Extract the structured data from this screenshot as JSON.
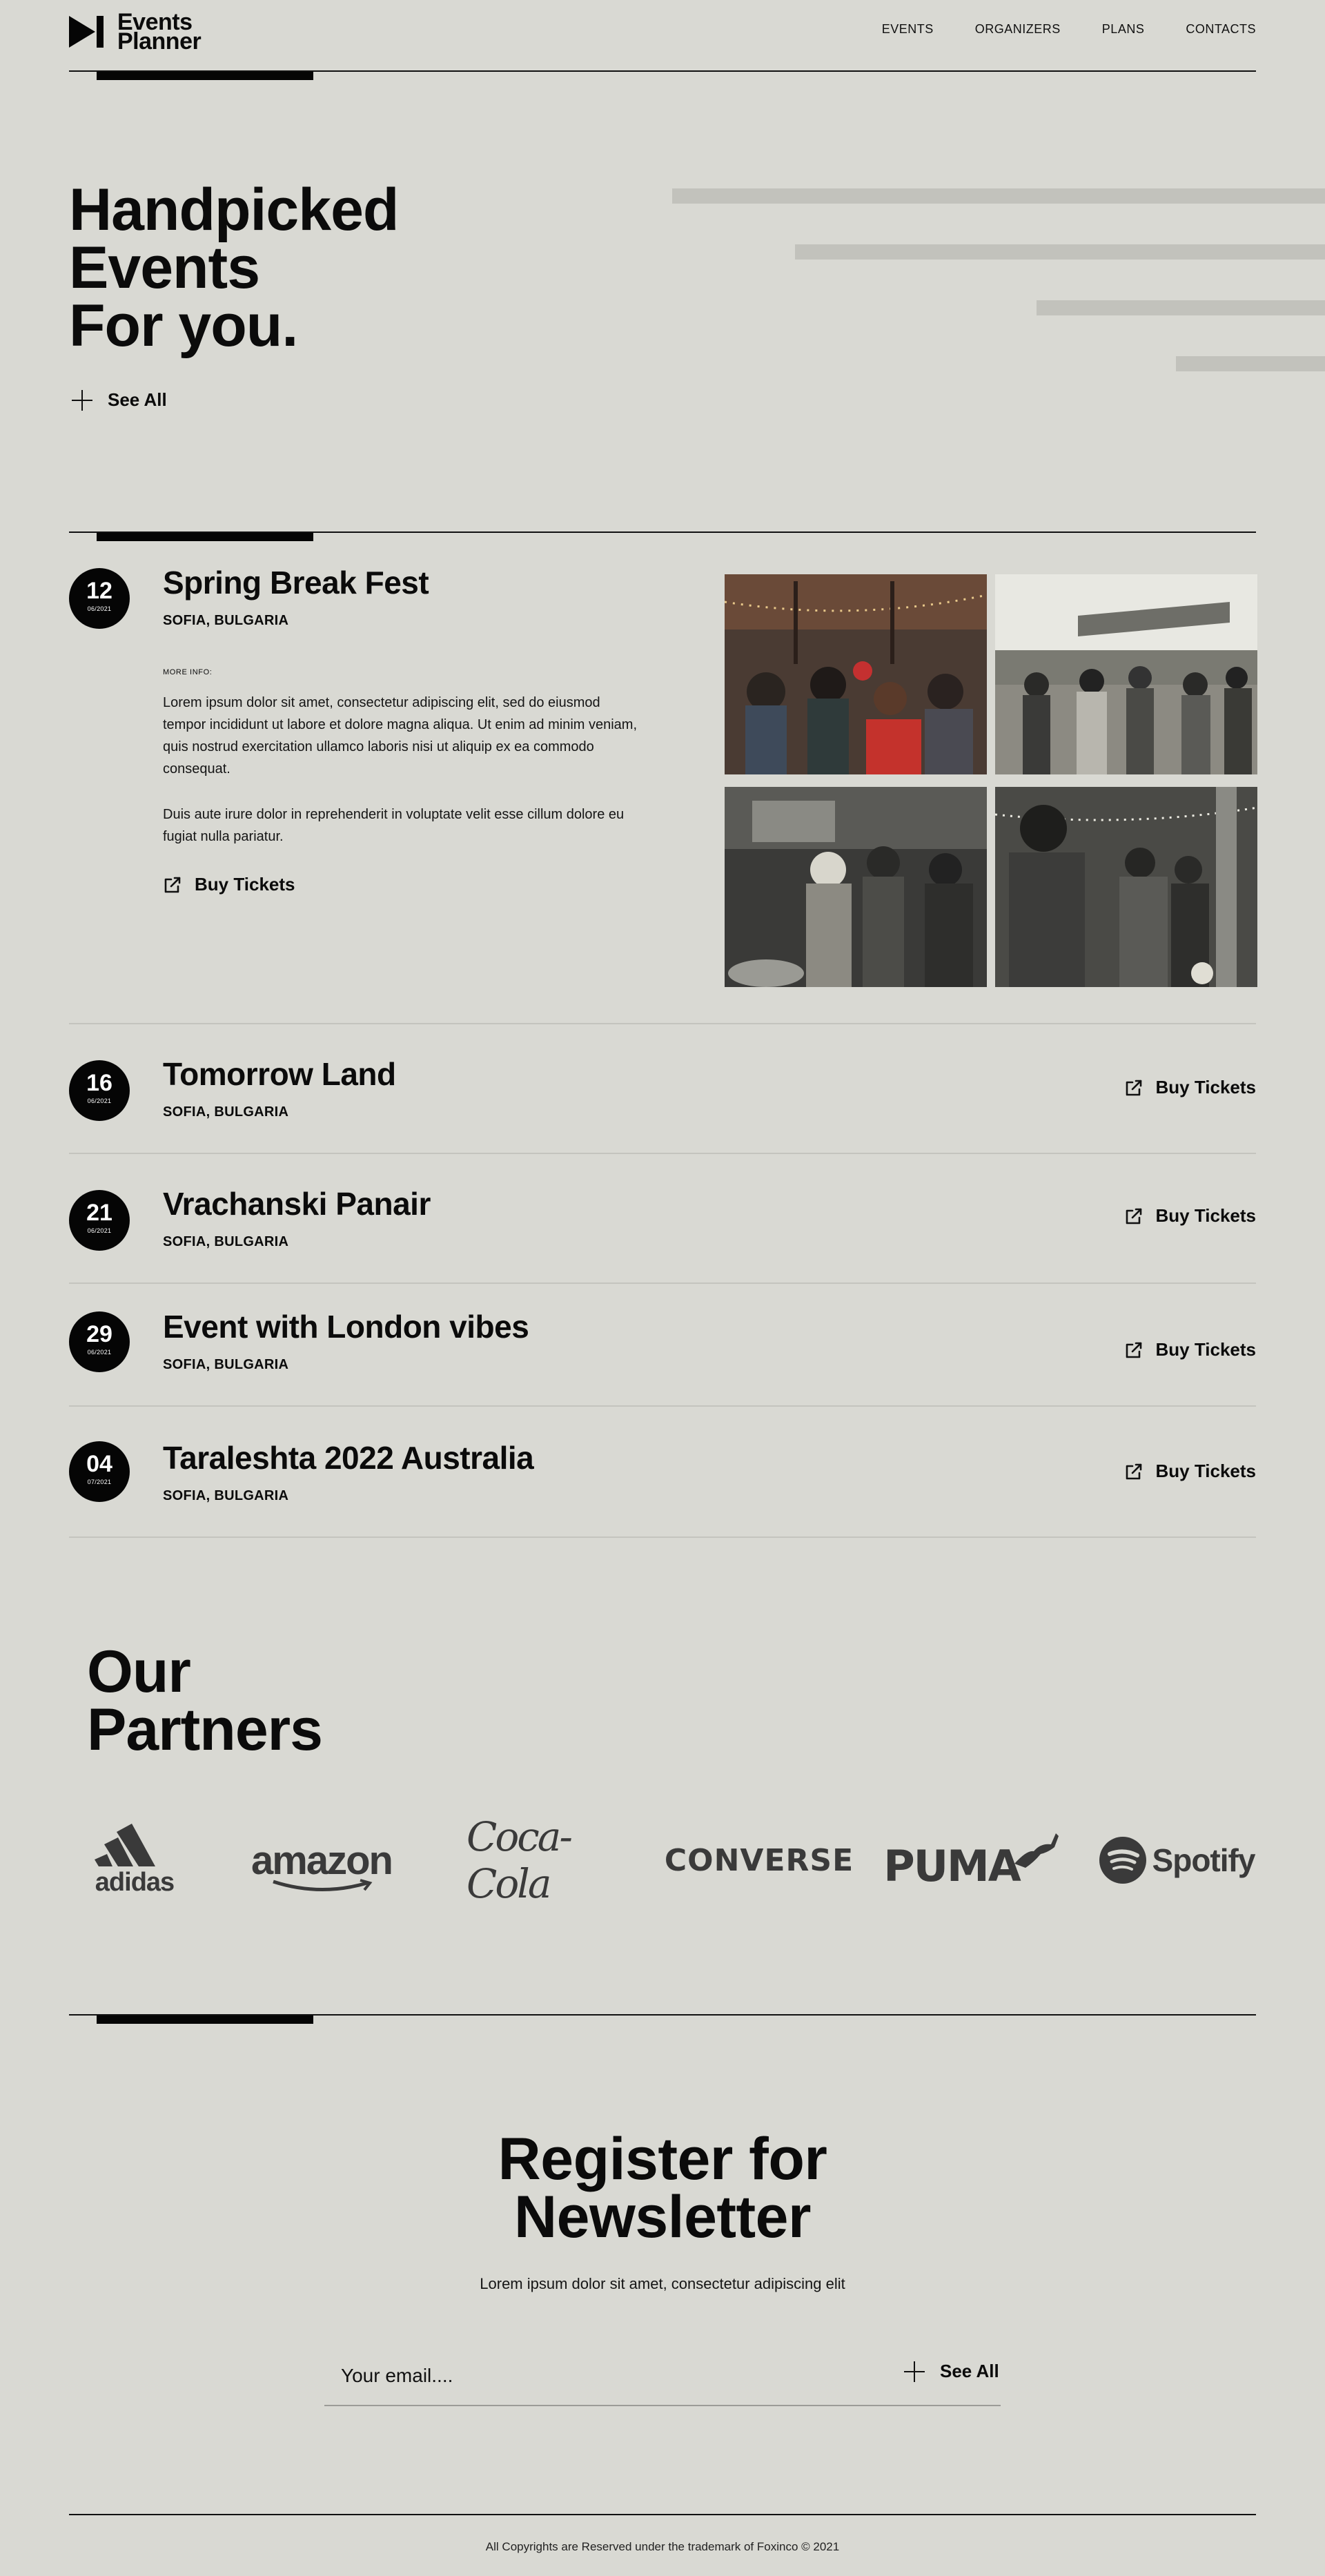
{
  "header": {
    "logo_line1": "Events",
    "logo_line2": "Planner",
    "nav": [
      "EVENTS",
      "ORGANIZERS",
      "PLANS",
      "CONTACTS"
    ]
  },
  "hero": {
    "title_line1": "Handpicked",
    "title_line2": "Events",
    "title_line3": "For you.",
    "see_all": "See All"
  },
  "featured_event": {
    "day": "12",
    "month": "06/2021",
    "title": "Spring Break Fest",
    "location": "SOFIA, BULGARIA",
    "more_info_label": "MORE INFO:",
    "paragraph1": "Lorem ipsum dolor sit amet, consectetur adipiscing elit, sed do eiusmod tempor incididunt ut labore et dolore magna aliqua. Ut enim ad minim veniam, quis nostrud exercitation ullamco laboris nisi ut aliquip ex ea commodo consequat.",
    "paragraph2": "Duis aute irure dolor in reprehenderit in voluptate velit esse cillum dolore eu fugiat nulla pariatur.",
    "buy_label": "Buy Tickets"
  },
  "events": [
    {
      "day": "16",
      "month": "06/2021",
      "title": "Tomorrow Land",
      "location": "SOFIA, BULGARIA",
      "buy_label": "Buy Tickets"
    },
    {
      "day": "21",
      "month": "06/2021",
      "title": "Vrachanski Panair",
      "location": "SOFIA, BULGARIA",
      "buy_label": "Buy Tickets"
    },
    {
      "day": "29",
      "month": "06/2021",
      "title": "Event with London vibes",
      "location": "SOFIA, BULGARIA",
      "buy_label": "Buy Tickets"
    },
    {
      "day": "04",
      "month": "07/2021",
      "title": "Taraleshta 2022 Australia",
      "location": "SOFIA, BULGARIA",
      "buy_label": "Buy Tickets"
    }
  ],
  "partners": {
    "title_line1": "Our",
    "title_line2": "Partners",
    "logos": [
      "adidas",
      "amazon",
      "Coca-Cola",
      "CONVERSE",
      "PUMA",
      "Spotify"
    ]
  },
  "newsletter": {
    "title_line1": "Register for",
    "title_line2": "Newsletter",
    "subtitle": "Lorem ipsum dolor sit amet, consectetur adipiscing elit",
    "email_placeholder": "Your email....",
    "submit_label": "See All"
  },
  "footer": {
    "copyright": "All Copyrights are Reserved under the trademark of Foxinco © 2021"
  }
}
